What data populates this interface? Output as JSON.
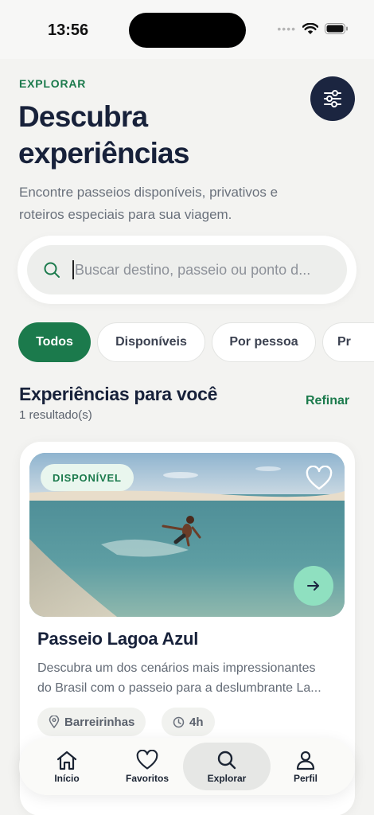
{
  "status_bar": {
    "time": "13:56"
  },
  "header": {
    "eyebrow": "EXPLORAR",
    "title": "Descubra experiências",
    "subtitle": "Encontre passeios disponíveis, privativos e roteiros especiais para sua viagem.",
    "filter_icon": "sliders-icon"
  },
  "search": {
    "placeholder": "Buscar destino, passeio ou ponto d...",
    "value": ""
  },
  "chips": [
    {
      "label": "Todos",
      "selected": true
    },
    {
      "label": "Disponíveis",
      "selected": false
    },
    {
      "label": "Por pessoa",
      "selected": false
    },
    {
      "label": "Pr",
      "selected": false
    }
  ],
  "section": {
    "title": "Experiências para você",
    "count": "1 resultado(s)",
    "refine_label": "Refinar"
  },
  "card": {
    "badge": "DISPONÍVEL",
    "title": "Passeio Lagoa Azul",
    "description_line1": "Descubra um dos cenários mais impressionantes",
    "description_line2": "do Brasil com o passeio para a deslumbrante La...",
    "location": "Barreirinhas",
    "duration": "4h"
  },
  "bottom_nav": [
    {
      "label": "Início",
      "icon": "home-icon",
      "active": false
    },
    {
      "label": "Favoritos",
      "icon": "heart-icon",
      "active": false
    },
    {
      "label": "Explorar",
      "icon": "search-icon",
      "active": true
    },
    {
      "label": "Perfil",
      "icon": "user-icon",
      "active": false
    }
  ],
  "colors": {
    "accent": "#1b7a4c",
    "navy": "#1b2540",
    "mint": "#8fe0c0",
    "background": "#f3f3f1"
  }
}
